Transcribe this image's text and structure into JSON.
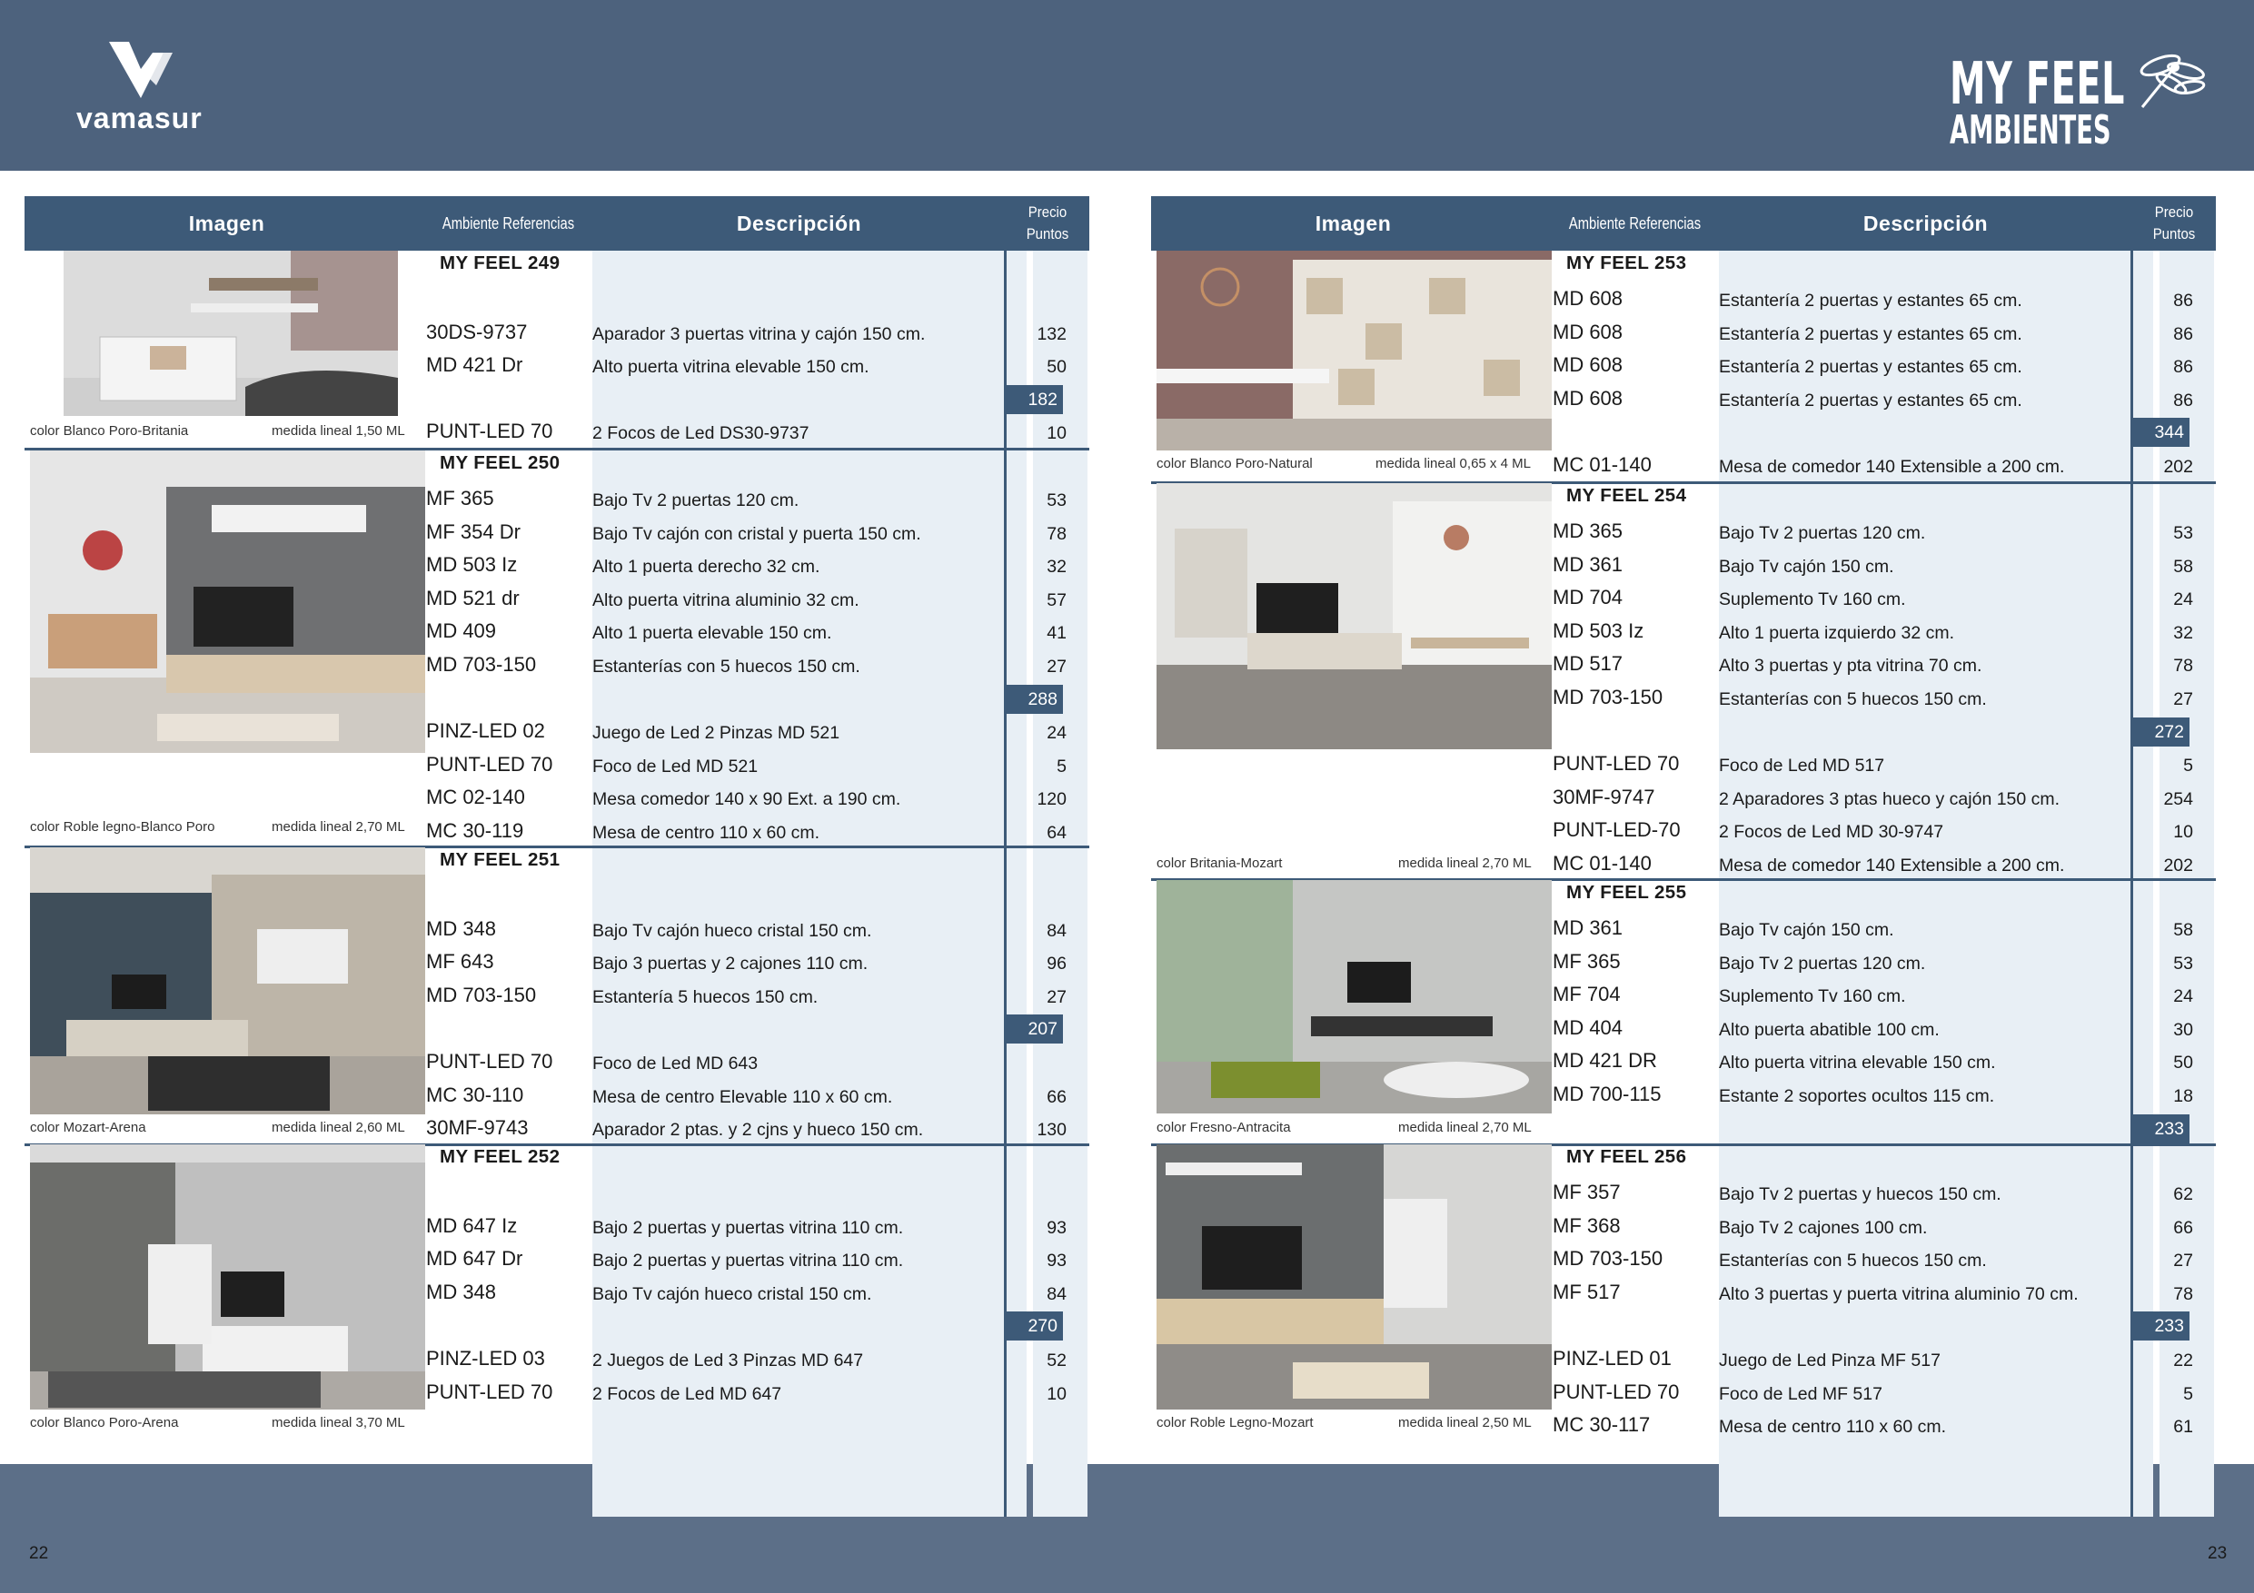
{
  "header": {
    "brand_left": "vamasur",
    "brand_right_line1": "MY FEEL",
    "brand_right_line2": "AMBIENTES"
  },
  "table_header": {
    "imagen": "Imagen",
    "ambiente": "Ambiente Referencias",
    "descripcion": "Descripción",
    "precio_line1": "Precio",
    "precio_line2": "Puntos"
  },
  "colors": {
    "header_bar": "#4d627d",
    "table_header": "#3d5a78",
    "column_tint": "#e8eff5"
  },
  "left_page": {
    "page_number": "22",
    "groups": [
      {
        "title": "MY FEEL 249",
        "color": "color Blanco Poro-Britania",
        "medida": "medida lineal 1,50 ML",
        "rows": [
          {
            "ref": "",
            "desc": "",
            "pts": ""
          },
          {
            "ref": "30DS-9737",
            "desc": "Aparador 3 puertas vitrina y  cajón 150 cm.",
            "pts": "132"
          },
          {
            "ref": "MD 421 Dr",
            "desc": "Alto puerta vitrina elevable 150 cm.",
            "pts": "50"
          },
          {
            "ref": "",
            "desc": "",
            "total": "182"
          },
          {
            "ref": "PUNT-LED 70",
            "desc": "2 Focos de Led DS30-9737",
            "pts": "10"
          }
        ]
      },
      {
        "title": "MY FEEL 250",
        "color": "color Roble legno-Blanco Poro",
        "medida": "medida lineal 2,70 ML",
        "rows": [
          {
            "ref": "MF 365",
            "desc": "Bajo Tv 2 puertas 120 cm.",
            "pts": "53"
          },
          {
            "ref": "MF 354 Dr",
            "desc": "Bajo Tv  cajón con cristal y puerta 150 cm.",
            "pts": "78"
          },
          {
            "ref": "MD 503 Iz",
            "desc": "Alto 1 puerta derecho 32 cm.",
            "pts": "32"
          },
          {
            "ref": "MD 521 dr",
            "desc": "Alto puerta vitrina aluminio 32 cm.",
            "pts": "57"
          },
          {
            "ref": "MD 409",
            "desc": "Alto 1 puerta elevable 150 cm.",
            "pts": "41"
          },
          {
            "ref": "MD 703-150",
            "desc": "Estanterías con 5 huecos 150 cm.",
            "pts": "27"
          },
          {
            "ref": "",
            "desc": "",
            "total": "288"
          },
          {
            "ref": "PINZ-LED 02",
            "desc": "Juego de Led 2 Pinzas MD 521",
            "pts": "24"
          },
          {
            "ref": "PUNT-LED 70",
            "desc": "Foco de Led MD 521",
            "pts": "5"
          },
          {
            "ref": "MC 02-140",
            "desc": "Mesa comedor 140 x 90 Ext. a 190 cm.",
            "pts": "120"
          },
          {
            "ref": "MC 30-119",
            "desc": "Mesa de centro 110 x 60 cm.",
            "pts": "64"
          }
        ]
      },
      {
        "title": "MY FEEL 251",
        "color": "color Mozart-Arena",
        "medida": "medida lineal 2,60 ML",
        "rows": [
          {
            "ref": "",
            "desc": "",
            "pts": ""
          },
          {
            "ref": "MD 348",
            "desc": "Bajo Tv cajón hueco cristal 150 cm.",
            "pts": "84"
          },
          {
            "ref": "MF 643",
            "desc": "Bajo 3 puertas y 2 cajones 110 cm.",
            "pts": "96"
          },
          {
            "ref": "MD 703-150",
            "desc": "Estantería 5 huecos 150 cm.",
            "pts": "27"
          },
          {
            "ref": "",
            "desc": "",
            "total": "207"
          },
          {
            "ref": "PUNT-LED 70",
            "desc": "Foco de Led MD 643",
            "pts": ""
          },
          {
            "ref": "MC 30-110",
            "desc": "Mesa de centro Elevable 110 x 60 cm.",
            "pts": "66"
          },
          {
            "ref": "30MF-9743",
            "desc": "Aparador 2 ptas. y 2 cjns y hueco 150 cm.",
            "pts": "130"
          }
        ]
      },
      {
        "title": "MY FEEL 252",
        "color": "color Blanco Poro-Arena",
        "medida": "medida lineal 3,70 ML",
        "rows": [
          {
            "ref": "",
            "desc": "",
            "pts": ""
          },
          {
            "ref": "MD 647 Iz",
            "desc": "Bajo 2 puertas y puertas vitrina 110 cm.",
            "pts": "93"
          },
          {
            "ref": "MD 647 Dr",
            "desc": "Bajo 2 puertas y puertas vitrina 110 cm.",
            "pts": "93"
          },
          {
            "ref": "MD 348",
            "desc": "Bajo Tv cajón hueco cristal 150 cm.",
            "pts": "84"
          },
          {
            "ref": "",
            "desc": "",
            "total": "270"
          },
          {
            "ref": "PINZ-LED 03",
            "desc": "2 Juegos de Led 3 Pinzas MD 647",
            "pts": "52"
          },
          {
            "ref": "PUNT-LED 70",
            "desc": "2 Focos de Led MD 647",
            "pts": "10"
          }
        ]
      }
    ]
  },
  "right_page": {
    "page_number": "23",
    "groups": [
      {
        "title": "MY FEEL 253",
        "color": "color Blanco Poro-Natural",
        "medida": "medida lineal 0,65 x 4 ML",
        "rows": [
          {
            "ref": "MD 608",
            "desc": "Estantería 2 puertas y estantes 65 cm.",
            "pts": "86"
          },
          {
            "ref": "MD 608",
            "desc": "Estantería 2 puertas y estantes 65 cm.",
            "pts": "86"
          },
          {
            "ref": "MD 608",
            "desc": "Estantería 2 puertas y estantes 65 cm.",
            "pts": "86"
          },
          {
            "ref": "MD 608",
            "desc": "Estantería 2 puertas y estantes 65 cm.",
            "pts": "86"
          },
          {
            "ref": "",
            "desc": "",
            "total": "344"
          },
          {
            "ref": "MC 01-140",
            "desc": "Mesa de comedor 140 Extensible a 200 cm.",
            "pts": "202"
          }
        ]
      },
      {
        "title": "MY FEEL 254",
        "color": "color Britania-Mozart",
        "medida": "medida lineal 2,70 ML",
        "rows": [
          {
            "ref": "MD 365",
            "desc": "Bajo Tv 2 puertas 120 cm.",
            "pts": "53"
          },
          {
            "ref": "MD 361",
            "desc": "Bajo Tv  cajón 150 cm.",
            "pts": "58"
          },
          {
            "ref": "MD 704",
            "desc": "Suplemento Tv 160 cm.",
            "pts": "24"
          },
          {
            "ref": "MD 503 Iz",
            "desc": "Alto 1 puerta izquierdo 32 cm.",
            "pts": "32"
          },
          {
            "ref": "MD 517",
            "desc": "Alto 3 puertas y pta vitrina 70 cm.",
            "pts": "78"
          },
          {
            "ref": "MD 703-150",
            "desc": "Estanterías con 5 huecos 150 cm.",
            "pts": "27"
          },
          {
            "ref": "",
            "desc": "",
            "total": "272"
          },
          {
            "ref": "PUNT-LED 70",
            "desc": "Foco de Led MD 517",
            "pts": "5"
          },
          {
            "ref": "30MF-9747",
            "desc": "2 Aparadores 3 ptas hueco y cajón 150 cm.",
            "pts": "254"
          },
          {
            "ref": "PUNT-LED-70",
            "desc": "2 Focos de Led MD 30-9747",
            "pts": "10"
          },
          {
            "ref": "MC 01-140",
            "desc": "Mesa de comedor 140 Extensible a 200 cm.",
            "pts": "202"
          }
        ]
      },
      {
        "title": "MY FEEL 255",
        "color": "color Fresno-Antracita",
        "medida": "medida lineal 2,70 ML",
        "rows": [
          {
            "ref": "MD 361",
            "desc": "Bajo Tv cajón 150 cm.",
            "pts": "58"
          },
          {
            "ref": "MF 365",
            "desc": "Bajo Tv 2 puertas 120 cm.",
            "pts": "53"
          },
          {
            "ref": "MF 704",
            "desc": "Suplemento Tv 160 cm.",
            "pts": "24"
          },
          {
            "ref": "MD 404",
            "desc": "Alto puerta abatible 100 cm.",
            "pts": "30"
          },
          {
            "ref": "MD 421 DR",
            "desc": "Alto puerta vitrina elevable 150 cm.",
            "pts": "50"
          },
          {
            "ref": "MD 700-115",
            "desc": "Estante 2 soportes ocultos 115 cm.",
            "pts": "18"
          },
          {
            "ref": "",
            "desc": "",
            "total": "233"
          }
        ]
      },
      {
        "title": "MY FEEL 256",
        "color": "color Roble Legno-Mozart",
        "medida": "medida lineal 2,50 ML",
        "rows": [
          {
            "ref": "MF 357",
            "desc": "Bajo Tv 2 puertas y huecos 150 cm.",
            "pts": "62"
          },
          {
            "ref": "MF 368",
            "desc": "Bajo Tv 2 cajones 100 cm.",
            "pts": "66"
          },
          {
            "ref": "MD 703-150",
            "desc": "Estanterías con 5 huecos 150 cm.",
            "pts": "27"
          },
          {
            "ref": "MF 517",
            "desc": "Alto 3 puertas y puerta vitrina aluminio 70 cm.",
            "pts": "78"
          },
          {
            "ref": "",
            "desc": "",
            "total": "233"
          },
          {
            "ref": "PINZ-LED 01",
            "desc": "Juego de Led Pinza MF 517",
            "pts": "22"
          },
          {
            "ref": "PUNT-LED 70",
            "desc": "Foco de Led MF 517",
            "pts": "5"
          },
          {
            "ref": "MC 30-117",
            "desc": "Mesa de centro 110 x 60 cm.",
            "pts": "61"
          }
        ]
      }
    ]
  }
}
